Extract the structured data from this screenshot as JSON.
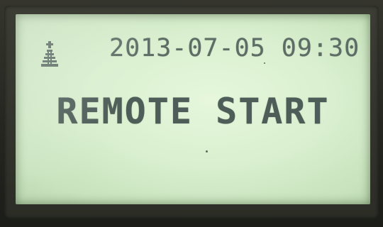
{
  "display": {
    "datetime": "2013-07-05 09:30",
    "message": "REMOTE START"
  },
  "icons": {
    "status_icon": "antenna-icon"
  },
  "colors": {
    "lcd_background": "#d9efcf",
    "lcd_text": "#5d6d66",
    "bezel": "#2c2d26"
  }
}
